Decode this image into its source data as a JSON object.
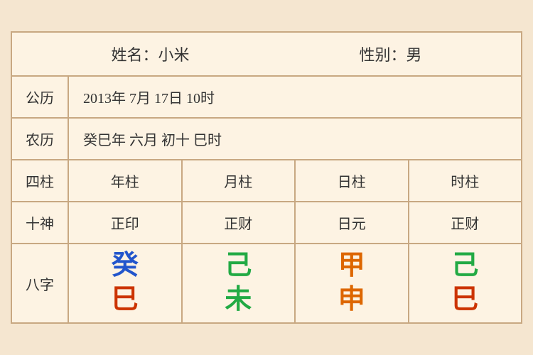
{
  "header": {
    "name_label": "姓名：小米",
    "gender_label": "性别：男"
  },
  "gregorian": {
    "label": "公历",
    "value": "2013年 7月 17日 10时"
  },
  "lunar": {
    "label": "农历",
    "value": "癸巳年 六月 初十 巳时"
  },
  "columns": {
    "label": "四柱",
    "year": "年柱",
    "month": "月柱",
    "day": "日柱",
    "hour": "时柱"
  },
  "shishen": {
    "label": "十神",
    "year": "正印",
    "month": "正财",
    "day": "日元",
    "hour": "正财"
  },
  "bazi": {
    "label": "八字",
    "year_top": "癸",
    "year_top_color": "blue",
    "year_bottom": "巳",
    "year_bottom_color": "red",
    "month_top": "己",
    "month_top_color": "green",
    "month_bottom": "未",
    "month_bottom_color": "green",
    "day_top": "甲",
    "day_top_color": "orange",
    "day_bottom": "申",
    "day_bottom_color": "orange",
    "hour_top": "己",
    "hour_top_color": "green",
    "hour_bottom": "巳",
    "hour_bottom_color": "red"
  }
}
